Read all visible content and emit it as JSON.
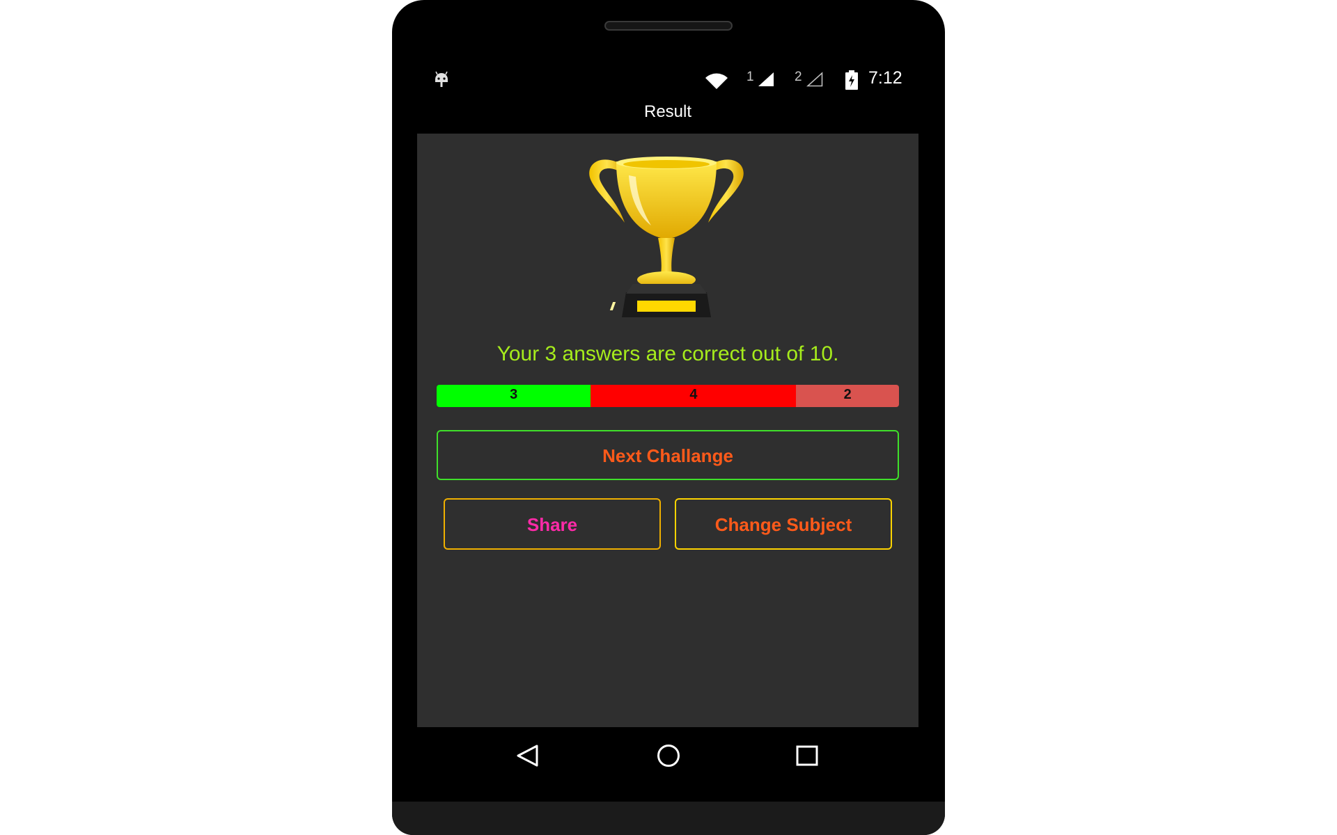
{
  "status_bar": {
    "sim1": "1",
    "sim2": "2",
    "time": "7:12",
    "icons": [
      "android-icon",
      "wifi-icon",
      "signal-icon",
      "signal-icon",
      "battery-charging-icon"
    ]
  },
  "header": {
    "title": "Result"
  },
  "result": {
    "message": "Your 3 answers are correct out of 10.",
    "trophy_icon": "trophy-icon"
  },
  "progress": {
    "total": 10,
    "segments": [
      {
        "label": "3",
        "value": 3,
        "color": "#00ff00"
      },
      {
        "label": "4",
        "value": 4,
        "color": "#ff0000"
      },
      {
        "label": "2",
        "value": 2,
        "color": "#d9534f"
      }
    ]
  },
  "buttons": {
    "next": "Next Challange",
    "share": "Share",
    "change_subject": "Change Subject"
  },
  "nav": {
    "icons": [
      "back-icon",
      "home-icon",
      "recents-icon"
    ]
  },
  "colors": {
    "content_background": "#2f2f2f",
    "result_text": "#a6ec1c",
    "next_border": "#3fe02a",
    "accent_orange": "#ff5a1a",
    "accent_pink": "#ff2aa8",
    "yellow_border": "#ffd400"
  }
}
